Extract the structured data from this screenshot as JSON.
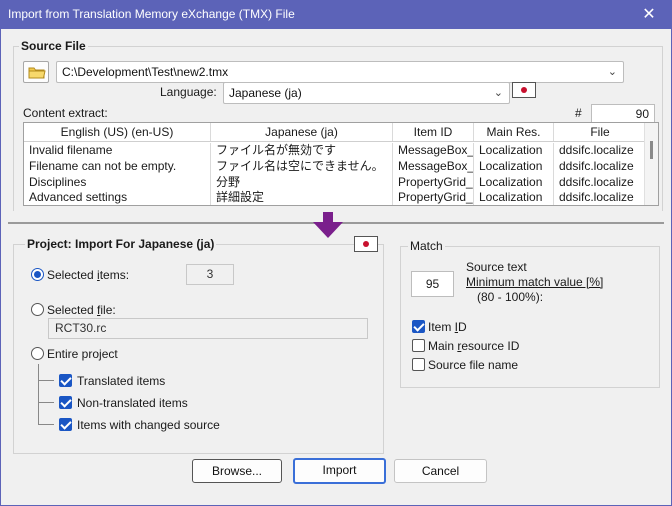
{
  "window": {
    "title": "Import from Translation Memory eXchange (TMX) File",
    "close_glyph": "✕"
  },
  "source_file": {
    "legend": "Source File",
    "path": "C:\\Development\\Test\\new2.tmx",
    "language_label": "Language:",
    "language_value": "Japanese (ja)",
    "content_extract_label": "Content extract:",
    "count_label": "#",
    "count_value": "90"
  },
  "table": {
    "columns": [
      "English (US) (en-US)",
      "Japanese (ja)",
      "Item ID",
      "Main Res.",
      "File"
    ],
    "rows": [
      [
        "Invalid filename",
        "ファイル名が無効です",
        "MessageBox_",
        "Localization",
        "ddsifc.localize"
      ],
      [
        "Filename can not be empty.",
        "ファイル名は空にできません。",
        "MessageBox_",
        "Localization",
        "ddsifc.localize"
      ],
      [
        "Disciplines",
        "分野",
        "PropertyGrid_",
        "Localization",
        "ddsifc.localize"
      ],
      [
        "Advanced settings",
        "詳細設定",
        "PropertyGrid_",
        "Localization",
        "ddsifc.localize"
      ]
    ]
  },
  "project": {
    "legend": "Project: Import For  Japanese (ja)",
    "selected_items_label_pre": "Selected ",
    "selected_items_label_u": "i",
    "selected_items_label_post": "tems:",
    "selected_items_count": "3",
    "selected_file_label_pre": "Selected ",
    "selected_file_label_u": "f",
    "selected_file_label_post": "ile:",
    "selected_file_value": "RCT30.rc",
    "entire_project_label": "Entire project",
    "translated_items": "Translated items",
    "non_translated_items": "Non-translated items",
    "items_changed_source": "Items with changed source"
  },
  "match": {
    "legend": "Match",
    "value": "95",
    "source_text_label": "Source text",
    "minimum_label": "Minimum match value [%]",
    "range_label": "(80 - 100%):",
    "item_id_pre": "Item ",
    "item_id_u": "I",
    "item_id_post": "D",
    "main_resource_pre": "Main ",
    "main_resource_u": "r",
    "main_resource_post": "esource ID",
    "source_file_name": "Source file name"
  },
  "buttons": {
    "browse": "Browse...",
    "import": "Import",
    "cancel": "Cancel"
  },
  "colors": {
    "titlebar": "#5c63b8",
    "accent": "#1a56c4",
    "arrow": "#7a1f8c",
    "flag_red": "#c8102e"
  }
}
